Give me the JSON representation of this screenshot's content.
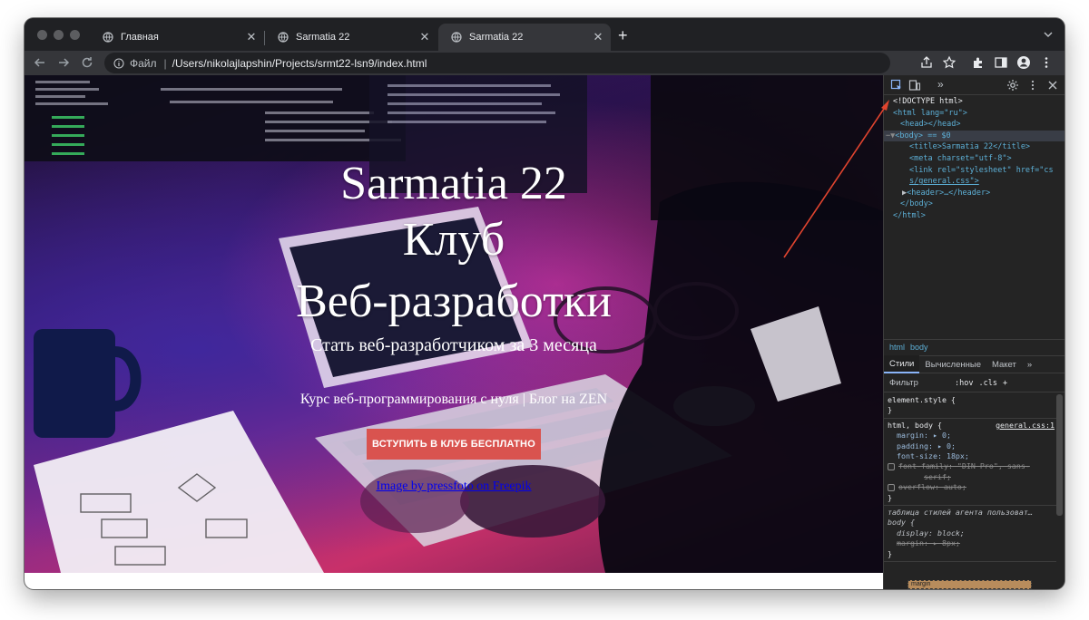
{
  "browser": {
    "tabs": [
      {
        "title": "Главная",
        "active": false
      },
      {
        "title": "Sarmatia 22",
        "active": false
      },
      {
        "title": "Sarmatia 22",
        "active": true
      }
    ],
    "address": {
      "scheme_label": "Файл",
      "divider": "|",
      "url": "/Users/nikolajlapshin/Projects/srmt22-lsn9/index.html"
    },
    "new_tab_symbol": "+",
    "close_symbol": "✕"
  },
  "page": {
    "title_lines": [
      "Sarmatia 22",
      "Клуб",
      "Веб-разработки"
    ],
    "subtitle": "Стать веб-разработчиком за 3 месяца",
    "course_line": "Курс веб-программирования с нуля | Блог на ZEN",
    "cta_label": "ВСТУПИТЬ В КЛУБ БЕСПЛАТНО",
    "credit": "Image by pressfoto on Freepik"
  },
  "devtools": {
    "more_symbol": "»",
    "dom": {
      "doctype": "<!DOCTYPE html>",
      "html_open": "<html lang=\"ru\">",
      "head": "<head></head>",
      "body_open": "<body> == $0",
      "title": "<title>Sarmatia 22</title>",
      "meta": "<meta charset=\"utf-8\">",
      "link_1": "<link rel=\"stylesheet\" href=\"cs",
      "link_2": "s/general.css\">",
      "header": "<header>…</header>",
      "body_close": "</body>",
      "html_close": "</html>"
    },
    "breadcrumbs": [
      "html",
      "body"
    ],
    "styles_tabs": [
      "Стили",
      "Вычисленные",
      "Макет",
      "»"
    ],
    "filter_placeholder": "Фильтр",
    "filter_options": [
      ":hov",
      ".cls",
      "+"
    ],
    "rules": {
      "element_style": "element.style {",
      "close_brace": "}",
      "html_body_selector": "html, body {",
      "html_body_source": "general.css:1",
      "margin": "margin: ▸ 0;",
      "padding": "padding: ▸ 0;",
      "font_size": "font-size: 18px;",
      "font_family": "font-family: \"DIN Pro\", sans-",
      "font_family_cont": "serif;",
      "overflow": "overflow: auto;",
      "ua_header": "таблица стилей агента пользоват…",
      "body_selector": "body {",
      "display": "display: block;",
      "body_margin": "margin: ▸ 8px;"
    },
    "box_model_label": "margin"
  },
  "colors": {
    "chrome_dark": "#202124",
    "toolbar": "#35363a",
    "devtools_bg": "#242424",
    "cta": "#d9534f",
    "arrow": "#e0442f"
  }
}
